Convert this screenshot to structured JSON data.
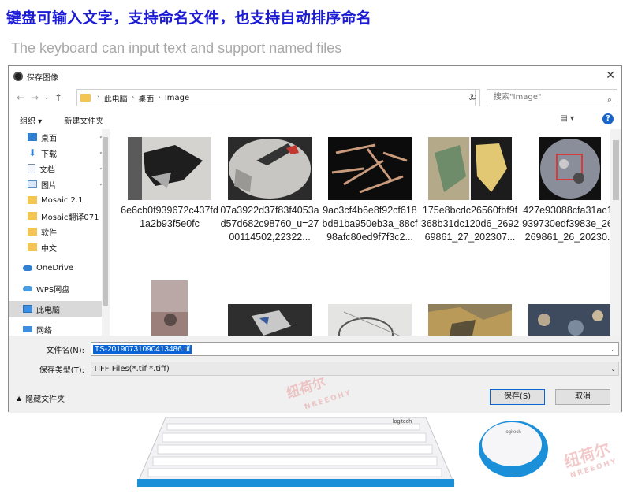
{
  "headline_cn": "键盘可输入文字，支持命名文件，也支持自动排序命名",
  "headline_en": "The keyboard can input text and support named files",
  "dialog": {
    "title": "保存图像",
    "close": "✕",
    "nav": {
      "back": "←",
      "forward": "→",
      "recent": "⌄",
      "up": "↑"
    },
    "breadcrumb": [
      "此电脑",
      "桌面",
      "Image"
    ],
    "refresh": "↻",
    "search_placeholder": "搜索\"Image\"",
    "toolbar": {
      "organize": "组织 ▾",
      "new_folder": "新建文件夹",
      "view": "▤ ▾",
      "help": "?"
    },
    "sidebar": [
      {
        "label": "桌面",
        "icon": "desktop-icon",
        "pinned": true
      },
      {
        "label": "下载",
        "icon": "download-icon",
        "pinned": true
      },
      {
        "label": "文档",
        "icon": "document-icon",
        "pinned": true
      },
      {
        "label": "图片",
        "icon": "picture-icon",
        "pinned": true
      },
      {
        "label": "Mosaic 2.1",
        "icon": "folder-icon",
        "pinned": false
      },
      {
        "label": "Mosaic翻译071",
        "icon": "folder-icon",
        "pinned": false
      },
      {
        "label": "软件",
        "icon": "folder-icon",
        "pinned": false
      },
      {
        "label": "中文",
        "icon": "folder-icon",
        "pinned": false
      },
      {
        "label": "OneDrive",
        "icon": "cloud-icon",
        "pinned": false
      },
      {
        "label": "WPS网盘",
        "icon": "cloud-icon",
        "pinned": false
      },
      {
        "label": "此电脑",
        "icon": "computer-icon",
        "pinned": false,
        "selected": true
      },
      {
        "label": "网络",
        "icon": "network-icon",
        "pinned": false
      }
    ],
    "pin_glyph": "📌",
    "files_row1": [
      "6e6cb0f939672c437fd1a2b93f5e0fc",
      "07a3922d37f83f4053ad57d682c98760_u=2700114502,22322...",
      "9ac3cf4b6e8f92cf618bd81ba950eb3a_88cf98afc80ed9f7f3c2...",
      "175e8bcdc26560fbf9f368b31dc120d6_269269861_27_202307...",
      "427e93088cfa31ac1c939730edf3983e_269269861_26_20230..."
    ],
    "file_name_label": "文件名(N):",
    "file_name_value": "TS-20190731090413486.tif",
    "save_type_label": "保存类型(T):",
    "save_type_value": "TIFF Files(*.tif *.tiff)",
    "hide_folders": "隐藏文件夹",
    "save_button": "保存(S)",
    "cancel_button": "取消"
  },
  "watermarks": [
    {
      "text": "纽荷尔"
    },
    {
      "text": "NREEOHY"
    },
    {
      "text": "纽荷尔"
    },
    {
      "text": "NREEOHY"
    }
  ],
  "keyboard_brand": "logitech",
  "mouse_brand": "logitech",
  "colors": {
    "headline_cn": "#1b1bd6",
    "headline_en": "#a9a9a9",
    "selection": "#0a64d6",
    "mouse_blue": "#1b8fd8"
  }
}
